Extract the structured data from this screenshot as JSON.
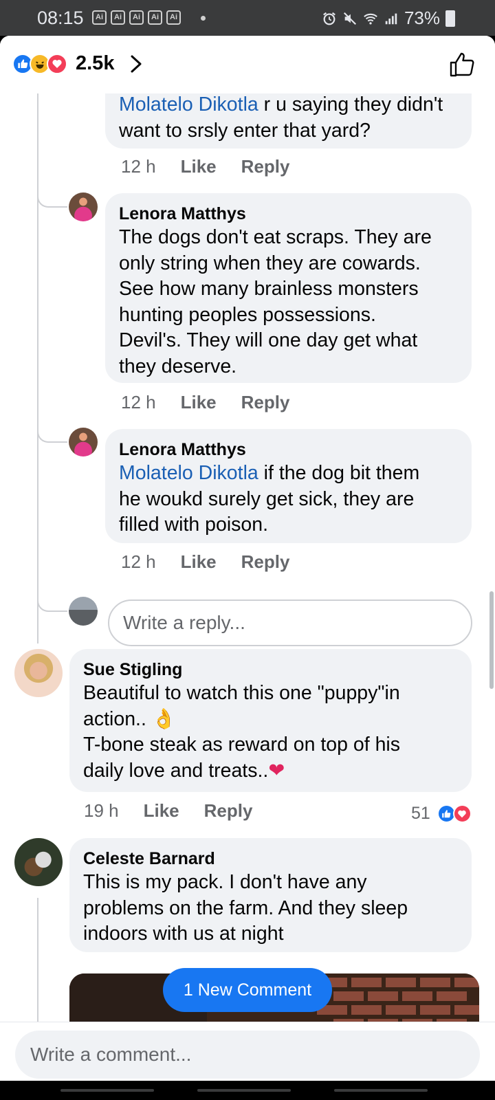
{
  "status_bar": {
    "time": "08:15",
    "badges": [
      "Ai",
      "Ai",
      "Ai",
      "Ai",
      "Ai"
    ],
    "battery": "73%",
    "icons": [
      "alarm-icon",
      "mute-icon",
      "wifi-icon",
      "signal-icon",
      "battery-icon"
    ]
  },
  "reactions_bar": {
    "count": "2.5k",
    "icons": [
      "like-icon",
      "haha-icon",
      "love-icon"
    ]
  },
  "comments": [
    {
      "mention": "Molatelo Dikotla",
      "text_line1_after_mention": " r u saying they didn't",
      "text_line2": "want to srsly enter that yard?",
      "time": "12 h",
      "like": "Like",
      "reply": "Reply"
    },
    {
      "author": "Lenora Matthys",
      "lines": [
        "The dogs don't eat scraps. They are",
        "only string when they are cowards.",
        "See how many brainless monsters",
        "hunting peoples possessions.",
        "Devil's. They will one day get what",
        "they deserve."
      ],
      "time": "12 h",
      "like": "Like",
      "reply": "Reply"
    },
    {
      "author": "Lenora Matthys",
      "mention": "Molatelo Dikotla",
      "text_line1_after_mention": " if the dog bit them",
      "text_line2": "he woukd surely get sick, they are",
      "text_line3": "filled with poison.",
      "time": "12 h",
      "like": "Like",
      "reply": "Reply"
    },
    {
      "author": "Sue Stigling",
      "line1": "Beautiful to watch this one \"puppy\"in",
      "line2": "action.. 👌",
      "line3": "T-bone steak as reward on top of his",
      "line4": "daily love and treats..",
      "time": "19 h",
      "like": "Like",
      "reply": "Reply",
      "reaction_count": "51"
    },
    {
      "author": "Celeste Barnard",
      "lines": [
        "This is my pack.  I don't have any",
        "problems on the farm. And they sleep",
        "indoors with us at night"
      ]
    }
  ],
  "reply_placeholder": "Write a reply...",
  "new_comment_pill": "1 New Comment",
  "comment_placeholder": "Write a comment...",
  "colors": {
    "accent": "#1877f2",
    "mention": "#1a5fb4",
    "bubble": "#f0f2f5",
    "meta_text": "#65676b",
    "love": "#f33e58",
    "haha": "#f7b928"
  }
}
